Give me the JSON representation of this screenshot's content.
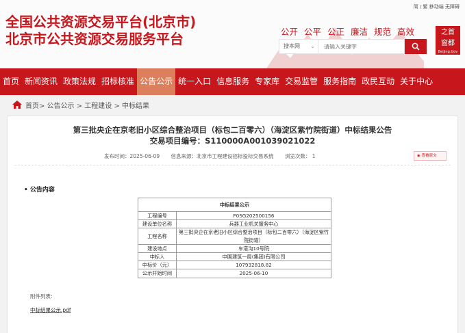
{
  "top_links": "简 / 繁  移动端  无障碍",
  "site": {
    "title_line1": "全国公共资源交易平台(北京市)",
    "title_line2": "北京市公共资源交易服务平台",
    "slogans": [
      "公开",
      "公平",
      "公正",
      "廉洁",
      "规范",
      "高效"
    ],
    "logo_text_1": "之首",
    "logo_text_2": "窗都",
    "logo_sub": "Beijing.Gov"
  },
  "search": {
    "scope": "搜本网",
    "placeholder": "请输入关键字"
  },
  "nav": {
    "items": [
      "首页",
      "新闻资讯",
      "政策法规",
      "招标核准",
      "公告公示",
      "统一入口",
      "信息服务",
      "专家库",
      "交易监管",
      "服务指南",
      "政民互动",
      "关于中心"
    ],
    "active_index": 4
  },
  "breadcrumb": "首页> 公告公示 > 工程建设 > 中标结果",
  "article": {
    "title": "第三批央企在京老旧小区综合整治项目（标包二百零六）（海淀区紫竹院街道）中标结果公告",
    "code_line": "交易项目编号：S110000A001039021022",
    "publish_time": "发布时间：2025-06-09",
    "source": "信息来源：北京市工程建设招标投标交易系统",
    "views": "浏览次数：   1",
    "view_original": "查看原文",
    "section_title": "• 公告内容"
  },
  "result_table": {
    "header": "中标结果公示",
    "rows": [
      {
        "label": "工程编号",
        "value": "F0SG202500156"
      },
      {
        "label": "建设单位名称",
        "value": "兵器工业机关服务中心"
      },
      {
        "label": "工程名称",
        "value": "第三批央企在京老旧小区综合整治项目（标包二百零六）（海淀区紫竹院街道）"
      },
      {
        "label": "建设地点",
        "value": "车道沟10号院"
      },
      {
        "label": "中标人",
        "value": "中国建筑一局(集团)有限公司"
      },
      {
        "label": "中标价（元）",
        "value": "107932818.82"
      },
      {
        "label": "公示开始时间",
        "value": "2025-06-10"
      }
    ]
  },
  "attachments": {
    "label": "附件列表:",
    "file": "中标结果公示.pdf"
  },
  "colors": {
    "brand": "#c8161d",
    "nav_active": "#dc7f5c"
  }
}
